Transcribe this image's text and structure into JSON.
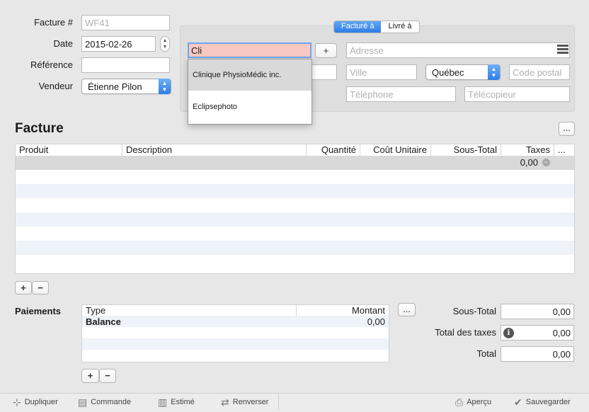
{
  "header": {
    "invoice_label": "Facture #",
    "invoice_placeholder": "WF41",
    "date_label": "Date",
    "date_value": "2015-02-26",
    "reference_label": "Référence",
    "reference_value": "",
    "vendor_label": "Vendeur",
    "vendor_value": "Étienne Pilon"
  },
  "address_panel": {
    "tabs": [
      "Facturé à",
      "Livré à"
    ],
    "active_tab": "Facturé à",
    "client_input": "Cli",
    "add_button": "+",
    "address_placeholder": "Adresse",
    "city_placeholder": "Ville",
    "province_value": "Québec",
    "postal_placeholder": "Code postal",
    "phone_placeholder": "Téléphone",
    "fax_placeholder": "Télécopieur",
    "suggestions": [
      "Clinique PhysioMédic inc.",
      "Eclipsephoto"
    ]
  },
  "invoice_section": {
    "title": "Facture",
    "more_button": "...",
    "columns": [
      "Produit",
      "Description",
      "Quantité",
      "Coût Unitaire",
      "Sous-Total",
      "Taxes",
      "..."
    ],
    "first_row_taxes": "0,00",
    "add_button": "+",
    "remove_button": "−"
  },
  "payments": {
    "title": "Paiements",
    "columns": [
      "Type",
      "Montant"
    ],
    "rows": [
      {
        "type": "Balance",
        "amount": "0,00"
      }
    ],
    "more_button": "...",
    "add_button": "+",
    "remove_button": "−"
  },
  "totals": {
    "subtotal_label": "Sous-Total",
    "subtotal_value": "0,00",
    "taxes_label": "Total des taxes",
    "taxes_value": "0,00",
    "total_label": "Total",
    "total_value": "0,00"
  },
  "toolbar": {
    "duplicate": "Dupliquer",
    "order": "Commande",
    "estimate": "Estimé",
    "reverse": "Renverser",
    "preview": "Aperçu",
    "save": "Sauvegarder"
  },
  "colors": {
    "accent": "#2f7de6",
    "client_input_bg": "#f8c9c2",
    "row_alt": "#eef3f9",
    "selected_row": "#d9d9d9"
  }
}
